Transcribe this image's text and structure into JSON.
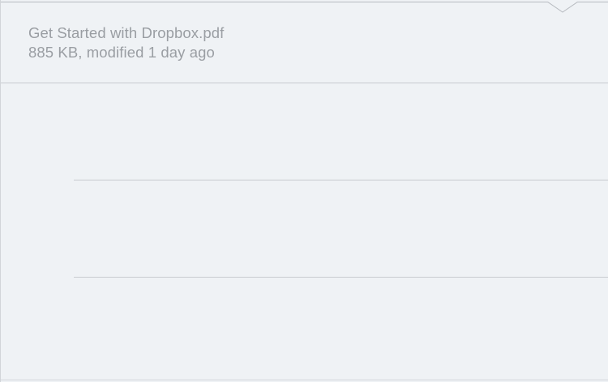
{
  "file": {
    "name": "Get Started with Dropbox.pdf",
    "meta": "885 KB, modified 1 day ago"
  },
  "list": {
    "rows": [
      "",
      "",
      ""
    ]
  },
  "icons": {
    "collapse": "chevron-down-icon"
  },
  "colors": {
    "background": "#eff2f5",
    "text_muted": "#9a9ea3",
    "divider": "#c8cbcf"
  }
}
